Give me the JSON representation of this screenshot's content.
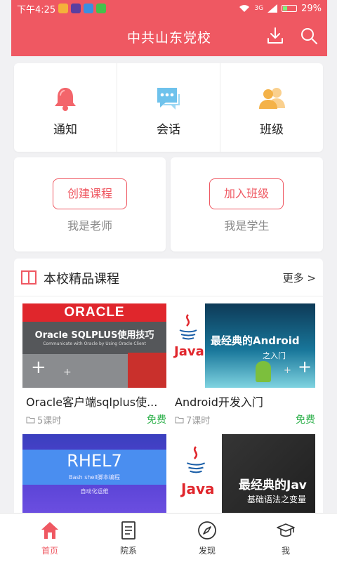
{
  "status_bar": {
    "time": "下午4:25",
    "network": "3G",
    "battery": "29%"
  },
  "header": {
    "title": "中共山东党校"
  },
  "quick_actions": [
    {
      "label": "通知",
      "icon": "bell-icon"
    },
    {
      "label": "会话",
      "icon": "chat-icon"
    },
    {
      "label": "班级",
      "icon": "people-icon"
    }
  ],
  "roles": {
    "teacher": {
      "button": "创建课程",
      "caption": "我是老师"
    },
    "student": {
      "button": "加入班级",
      "caption": "我是学生"
    }
  },
  "featured": {
    "title": "本校精品课程",
    "more": "更多 >",
    "courses": [
      {
        "title": "Oracle客户端sqlplus使...",
        "lessons": "5课时",
        "price": "免费",
        "thumb": {
          "brand": "ORACLE",
          "headline": "Oracle SQLPLUS使用技巧",
          "sub": "Communicate with Oracle by Using Oracle Client"
        }
      },
      {
        "title": "Android开发入门",
        "lessons": "7课时",
        "price": "免费",
        "thumb": {
          "brand": "Java",
          "headline": "最经典的Android",
          "sub": "之入门"
        }
      },
      {
        "title": "",
        "lessons": "",
        "price": "",
        "thumb": {
          "brand": "",
          "headline": "RHEL7",
          "sub": "Bash shell脚本编程",
          "sub2": "自动化运维"
        }
      },
      {
        "title": "",
        "lessons": "",
        "price": "",
        "thumb": {
          "brand": "Java",
          "headline": "最经典的Jav",
          "sub": "基础语法之变量"
        }
      }
    ]
  },
  "bottom_nav": [
    {
      "label": "首页",
      "icon": "home-icon",
      "active": true
    },
    {
      "label": "院系",
      "icon": "book-icon",
      "active": false
    },
    {
      "label": "发现",
      "icon": "compass-icon",
      "active": false
    },
    {
      "label": "我",
      "icon": "graduation-cap-icon",
      "active": false
    }
  ],
  "colors": {
    "brand": "#ef5862",
    "free": "#2cb04a",
    "background": "#f1f1f3"
  }
}
